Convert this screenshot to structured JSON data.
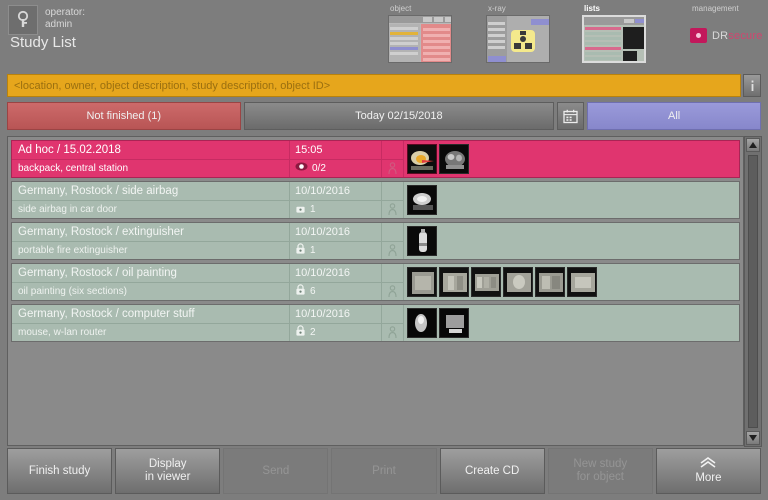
{
  "header": {
    "operator_label": "operator:",
    "operator_name": "admin",
    "page_title": "Study List",
    "operator_icon": "key-user-icon"
  },
  "modules": [
    {
      "label": "object",
      "name": "object",
      "active": false
    },
    {
      "label": "x-ray",
      "name": "xray",
      "active": false
    },
    {
      "label": "lists",
      "name": "lists",
      "active": true
    },
    {
      "label": "management",
      "name": "management",
      "active": false
    }
  ],
  "logo": {
    "prefix": "DR",
    "suffix": "secure"
  },
  "search": {
    "value": "",
    "placeholder": "<location, owner, object description, study description, object ID>",
    "side_button_icon": "info-icon"
  },
  "filters": [
    {
      "label": "Not finished (1)",
      "name": "not-finished",
      "state": "active-red"
    },
    {
      "label": "Today 02/15/2018",
      "name": "today",
      "state": "normal"
    },
    {
      "label": "",
      "name": "calendar",
      "state": "icon",
      "icon": "calendar-icon"
    },
    {
      "label": "All",
      "name": "all",
      "state": "active-blue"
    }
  ],
  "studies": [
    {
      "title": "Ad hoc / 15.02.2018",
      "subtitle": "backpack, central station",
      "date": "15:05",
      "count": "0/2",
      "count_icon": "eye-icon",
      "person_icon": "person-icon",
      "selected": true,
      "thumbs": [
        "xray-color",
        "xray-gray"
      ]
    },
    {
      "title": "Germany, Rostock / side airbag",
      "subtitle": "side airbag in car door",
      "date": "10/10/2016",
      "count": "1",
      "count_icon": "lock-icon",
      "person_icon": "person-icon",
      "selected": false,
      "thumbs": [
        "xray-gray"
      ]
    },
    {
      "title": "Germany, Rostock / extinguisher",
      "subtitle": "portable fire extinguisher",
      "date": "10/10/2016",
      "count": "1",
      "count_icon": "lock-icon",
      "person_icon": "person-icon",
      "selected": false,
      "thumbs": [
        "xray-gray"
      ]
    },
    {
      "title": "Germany, Rostock / oil painting",
      "subtitle": "oil painting (six sections)",
      "date": "10/10/2016",
      "count": "6",
      "count_icon": "lock-icon",
      "person_icon": "person-icon",
      "selected": false,
      "thumbs": [
        "xray-gray",
        "xray-gray",
        "xray-gray",
        "xray-gray",
        "xray-gray",
        "xray-gray"
      ]
    },
    {
      "title": "Germany, Rostock / computer stuff",
      "subtitle": "mouse, w-lan router",
      "date": "10/10/2016",
      "count": "2",
      "count_icon": "lock-icon",
      "person_icon": "person-icon",
      "selected": false,
      "thumbs": [
        "xray-gray",
        "xray-gray"
      ]
    }
  ],
  "scrollbar": {
    "up_icon": "triangle-up-icon",
    "down_icon": "triangle-down-icon"
  },
  "toolbar": [
    {
      "label": "Finish study",
      "name": "finish-study",
      "disabled": false,
      "icon": ""
    },
    {
      "label": "Display\nin viewer",
      "name": "display-viewer",
      "disabled": false,
      "icon": ""
    },
    {
      "label": "Send",
      "name": "send",
      "disabled": true,
      "icon": ""
    },
    {
      "label": "Print",
      "name": "print",
      "disabled": true,
      "icon": ""
    },
    {
      "label": "Create CD",
      "name": "create-cd",
      "disabled": false,
      "icon": ""
    },
    {
      "label": "New study\nfor object",
      "name": "new-study",
      "disabled": true,
      "icon": ""
    },
    {
      "label": "More",
      "name": "more",
      "disabled": false,
      "icon": "chevron-up-icon"
    }
  ],
  "colors": {
    "background": "#7d7d7d",
    "selected_row": "#e0356f",
    "row": "#a9bbb0",
    "search": "#e6a61c",
    "filter_red": "#c06060",
    "filter_blue": "#9090d2",
    "logo_pink": "#c2185b"
  }
}
